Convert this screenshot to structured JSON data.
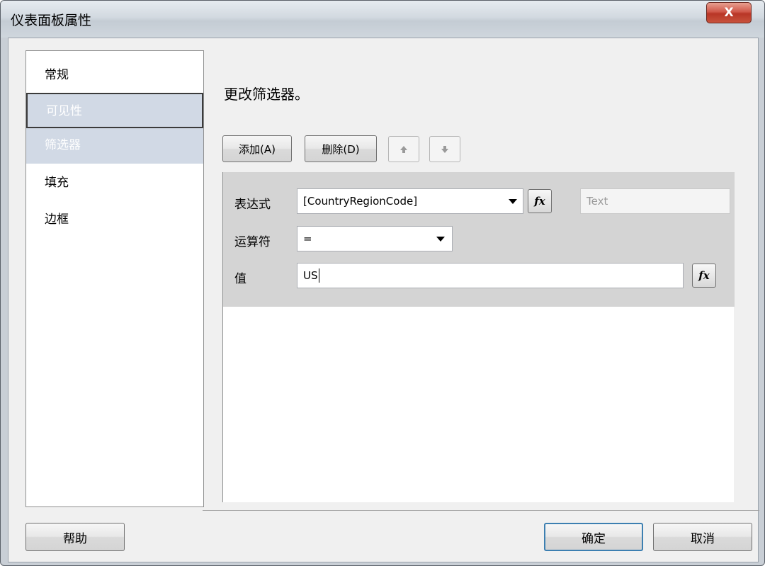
{
  "window": {
    "title": "仪表面板属性",
    "close_label": "X"
  },
  "nav": {
    "items": [
      {
        "label": "常规"
      },
      {
        "label": "可见性"
      },
      {
        "label": "筛选器"
      },
      {
        "label": "填充"
      },
      {
        "label": "边框"
      }
    ]
  },
  "main": {
    "heading": "更改筛选器。",
    "toolbar": {
      "add_label": "添加(A)",
      "delete_label": "删除(D)",
      "up_icon": "arrow-up-icon",
      "down_icon": "arrow-down-icon"
    },
    "filter": {
      "expression_label": "表达式",
      "expression_value": "[CountryRegionCode]",
      "type_value": "Text",
      "operator_label": "运算符",
      "operator_value": "=",
      "value_label": "值",
      "value_value": "US",
      "fx_label": "fx"
    }
  },
  "footer": {
    "help_label": "帮助",
    "ok_label": "确定",
    "cancel_label": "取消"
  },
  "colors": {
    "selected_bg": "#d1d9e5",
    "filter_bg": "#d4d4d4",
    "ok_border": "#3c7fb1"
  }
}
